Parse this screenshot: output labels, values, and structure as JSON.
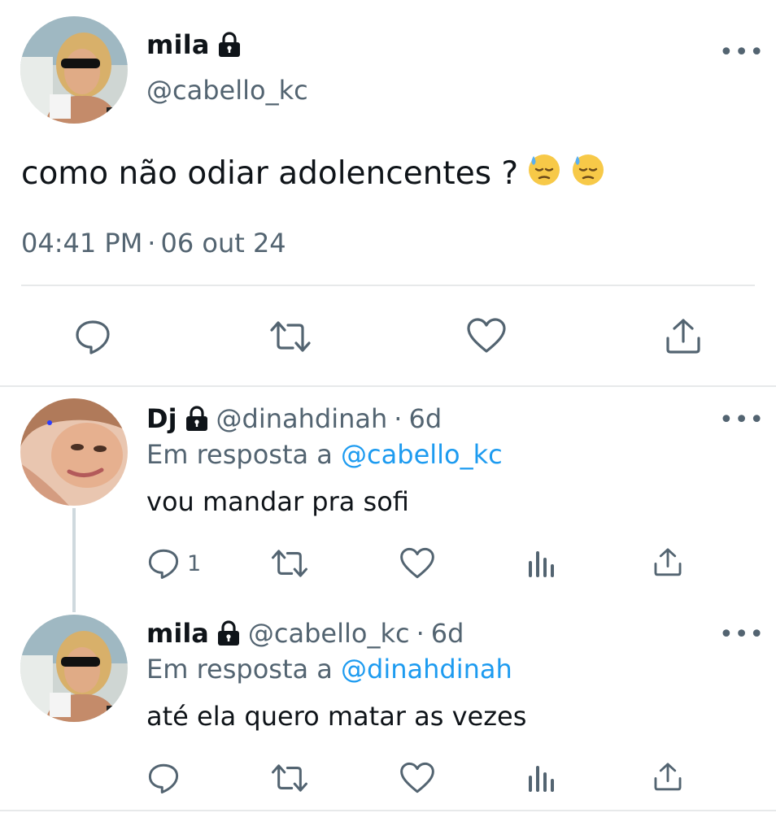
{
  "main_tweet": {
    "display_name": "mila",
    "handle": "@cabello_kc",
    "text": "como não odiar adolencentes ?",
    "emojis": [
      "downcast-sweat-face",
      "downcast-sweat-face"
    ],
    "time": "04:41 PM",
    "date": "06 out 24",
    "separator": "·"
  },
  "replies": [
    {
      "display_name": "Dj",
      "handle": "@dinahdinah",
      "age": "6d",
      "separator": "·",
      "reply_prefix": "Em resposta a",
      "reply_to": "@cabello_kc",
      "text": "vou mandar pra sofi",
      "reply_count": "1"
    },
    {
      "display_name": "mila",
      "handle": "@cabello_kc",
      "age": "6d",
      "separator": "·",
      "reply_prefix": "Em resposta a",
      "reply_to": "@dinahdinah",
      "text": "até ela quero matar as vezes",
      "reply_count": ""
    }
  ],
  "more_label": "•••",
  "colors": {
    "text": "#0f1419",
    "secondary": "#536471",
    "link": "#1d9bf0",
    "divider": "#e7e9ea"
  },
  "icons": [
    "lock-icon",
    "more-icon",
    "reply-icon",
    "retweet-icon",
    "like-icon",
    "share-icon",
    "analytics-icon"
  ]
}
